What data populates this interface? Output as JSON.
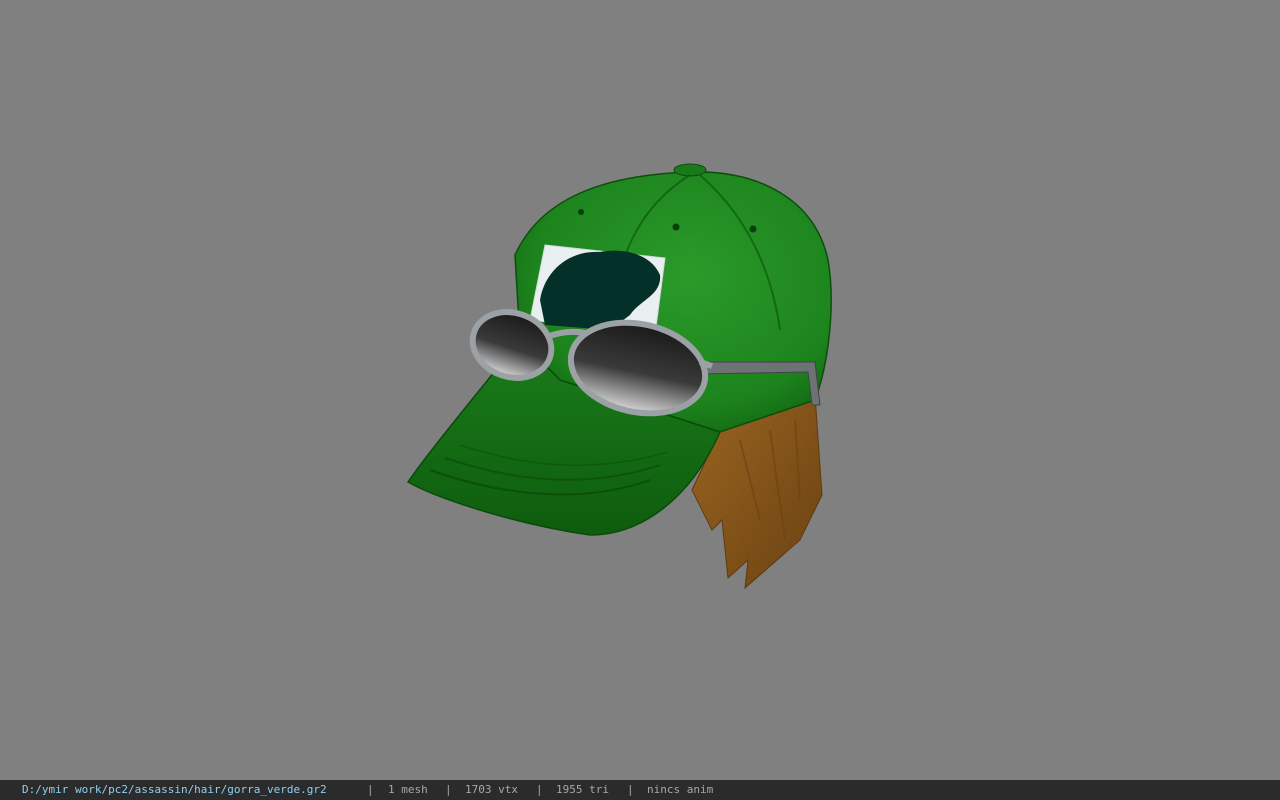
{
  "viewport": {
    "background_color": "#808080",
    "model": {
      "name": "green-baseball-cap-with-sunglasses-and-hair",
      "cap_color": "#1f8a1f",
      "cap_dark_color": "#0f5c0f",
      "logo_patch_color": "#e8eef0",
      "logo_mark_color": "#062a26",
      "glasses_frame_color": "#8a8f92",
      "hair_color": "#8a5a1a"
    }
  },
  "statusbar": {
    "file_path": "D:/ymir work/pc2/assassin/hair/gorra_verde.gr2",
    "separator": "|",
    "mesh_count": "1 mesh",
    "vertex_count": "1703 vtx",
    "triangle_count": "1955 tri",
    "anim_status": "nincs anim"
  }
}
